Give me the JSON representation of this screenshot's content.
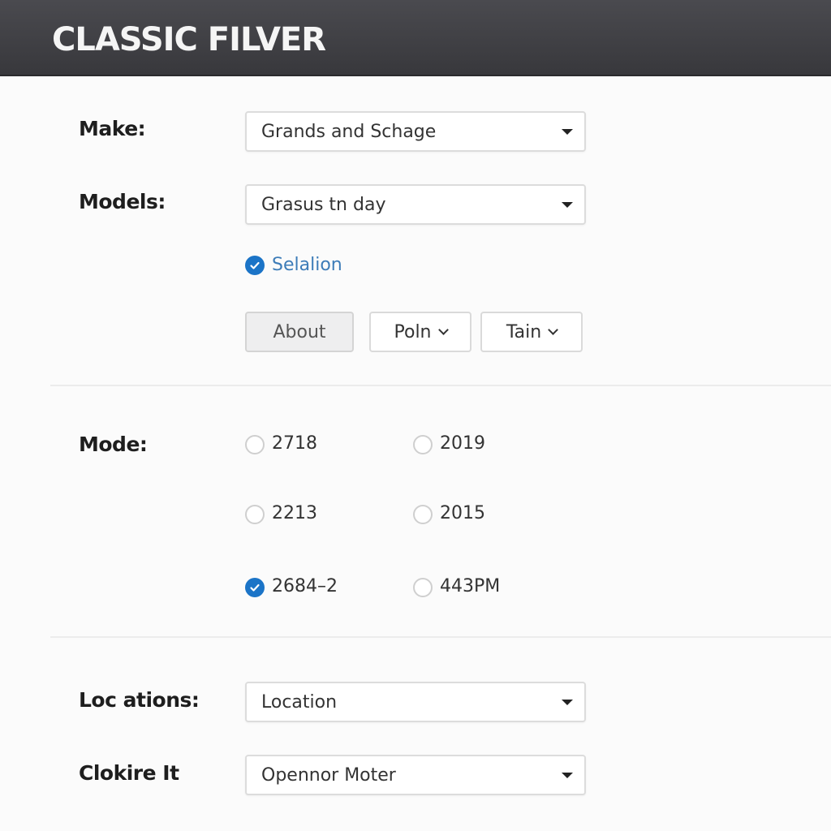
{
  "header": {
    "title": "CLASSIC FILVER"
  },
  "form": {
    "make": {
      "label": "Make:",
      "value": "Grands and Schage"
    },
    "models": {
      "label": "Models:",
      "value": "Grasus tn day"
    },
    "selection_checkbox": {
      "label": "Selalion",
      "checked": true
    },
    "buttons": [
      {
        "label": "About",
        "active": true,
        "has_dropdown": false
      },
      {
        "label": "Poln",
        "active": false,
        "has_dropdown": true
      },
      {
        "label": "Tain",
        "active": false,
        "has_dropdown": true
      }
    ],
    "mode": {
      "label": "Mode:",
      "options": [
        {
          "label": "2718",
          "checked": false
        },
        {
          "label": "2019",
          "checked": false
        },
        {
          "label": "2213",
          "checked": false
        },
        {
          "label": "2015",
          "checked": false
        },
        {
          "label": "2684–2",
          "checked": true
        },
        {
          "label": "443PM",
          "checked": false
        }
      ]
    },
    "locations": {
      "label": "Loc ations:",
      "value": "Location"
    },
    "clokire": {
      "label": "Clokire It",
      "value": "Opennor Moter"
    }
  },
  "colors": {
    "accent": "#1b74c7",
    "header_bg": "#3f3f43",
    "selection_text": "#3d7cb8"
  }
}
